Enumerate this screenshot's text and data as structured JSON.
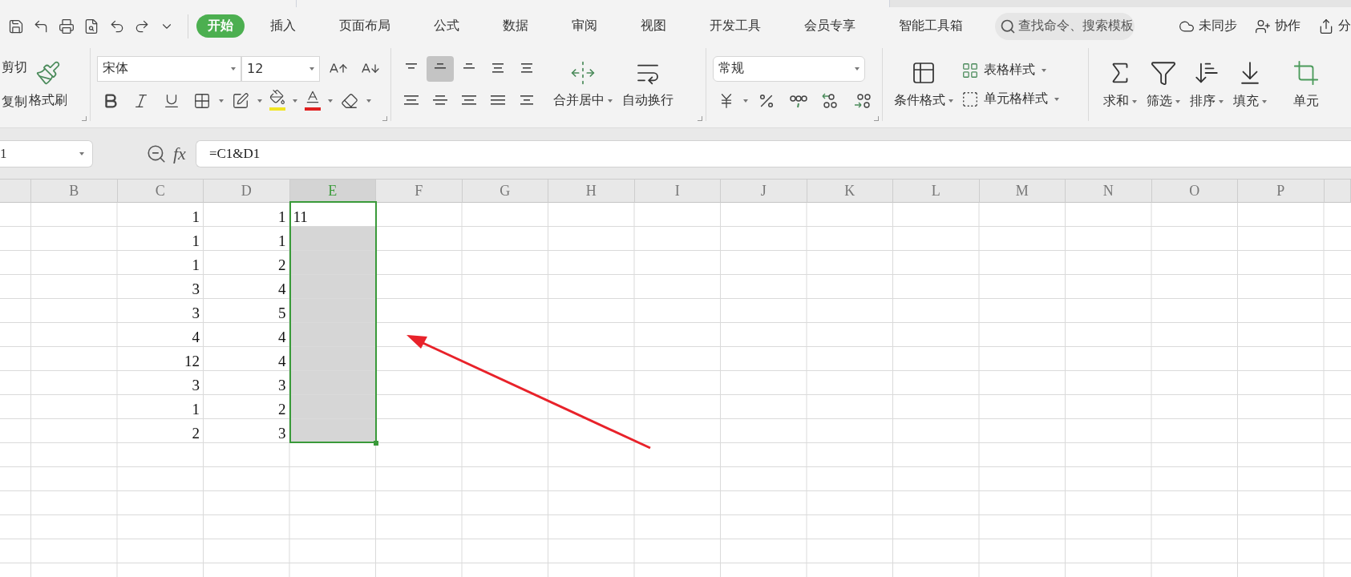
{
  "menu": {
    "tabs": [
      {
        "label": "开始",
        "selected": true
      },
      {
        "label": "插入",
        "selected": false
      },
      {
        "label": "页面布局",
        "selected": false
      },
      {
        "label": "公式",
        "selected": false
      },
      {
        "label": "数据",
        "selected": false
      },
      {
        "label": "审阅",
        "selected": false
      },
      {
        "label": "视图",
        "selected": false
      },
      {
        "label": "开发工具",
        "selected": false
      },
      {
        "label": "会员专享",
        "selected": false
      },
      {
        "label": "智能工具箱",
        "selected": false
      }
    ],
    "search": {
      "placeholder": "查找命令、搜索模板"
    },
    "actions": [
      {
        "kind": "sync",
        "label": "未同步"
      },
      {
        "kind": "collab",
        "label": "协作"
      },
      {
        "kind": "share",
        "label": "分"
      }
    ]
  },
  "ribbon": {
    "clipboard": [
      "剪切",
      "复制"
    ],
    "format_painter": "格式刷",
    "font": {
      "name": "宋体",
      "size": "12"
    },
    "merge": "合并居中",
    "wrap": "自动换行",
    "number_format": "常规",
    "conditional_format": "条件格式",
    "table_style": "表格样式",
    "cell_style": "单元格样式",
    "tools": [
      {
        "kind": "sum",
        "label": "求和"
      },
      {
        "kind": "filter",
        "label": "筛选"
      },
      {
        "kind": "sort",
        "label": "排序"
      },
      {
        "kind": "fill",
        "label": "填充"
      },
      {
        "kind": "cell",
        "label": "单元"
      }
    ]
  },
  "formula_bar": {
    "name_box": "1",
    "fx": "fx",
    "formula": "=C1&D1"
  },
  "sheet": {
    "columns": [
      {
        "label": "B",
        "selected": false
      },
      {
        "label": "C",
        "selected": false
      },
      {
        "label": "D",
        "selected": false
      },
      {
        "label": "E",
        "selected": true
      },
      {
        "label": "F",
        "selected": false
      },
      {
        "label": "G",
        "selected": false
      },
      {
        "label": "H",
        "selected": false
      },
      {
        "label": "I",
        "selected": false
      },
      {
        "label": "J",
        "selected": false
      },
      {
        "label": "K",
        "selected": false
      },
      {
        "label": "L",
        "selected": false
      },
      {
        "label": "M",
        "selected": false
      },
      {
        "label": "N",
        "selected": false
      },
      {
        "label": "O",
        "selected": false
      },
      {
        "label": "P",
        "selected": false
      }
    ],
    "rows": [
      {
        "c": "1",
        "d": "1",
        "e": "11",
        "e_selected": true,
        "e_active": true
      },
      {
        "c": "1",
        "d": "1",
        "e_selected": true,
        "e_active": false
      },
      {
        "c": "1",
        "d": "2",
        "e_selected": true,
        "e_active": false
      },
      {
        "c": "3",
        "d": "4",
        "e_selected": true,
        "e_active": false
      },
      {
        "c": "3",
        "d": "5",
        "e_selected": true,
        "e_active": false
      },
      {
        "c": "4",
        "d": "4",
        "e_selected": true,
        "e_active": false
      },
      {
        "c": "12",
        "d": "4",
        "e_selected": true,
        "e_active": false
      },
      {
        "c": "3",
        "d": "3",
        "e_selected": true,
        "e_active": false
      },
      {
        "c": "1",
        "d": "2",
        "e_selected": true,
        "e_active": false
      },
      {
        "c": "2",
        "d": "3",
        "e_selected": true,
        "e_active": false
      }
    ]
  }
}
